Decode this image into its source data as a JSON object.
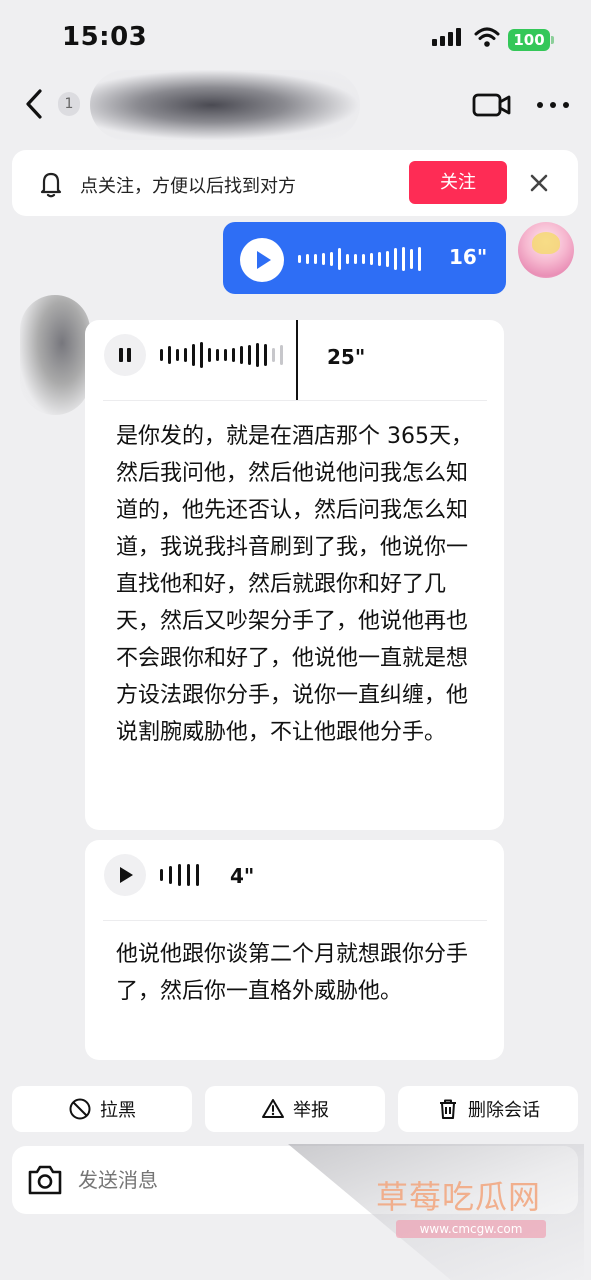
{
  "status_bar": {
    "time": "15:03",
    "battery": "100",
    "battery_color": "#34c759"
  },
  "header": {
    "unread_count": "1",
    "icons": [
      "back-icon",
      "video-call-icon",
      "more-icon"
    ]
  },
  "follow_banner": {
    "text": "点关注，方便以后找到对方",
    "button_label": "关注",
    "button_color": "#fe2c55"
  },
  "messages": [
    {
      "from": "me",
      "type": "voice",
      "duration": "16\"",
      "bubble_color": "#2e6ef5"
    },
    {
      "from": "other",
      "type": "voice",
      "state": "playing",
      "duration": "25\"",
      "transcript": "是你发的，就是在酒店那个 365天，然后我问他，然后他说他问我怎么知道的，他先还否认，然后问我怎么知道，我说我抖音刷到了我，他说你一直找他和好，然后就跟你和好了几天，然后又吵架分手了，他说他再也不会跟你和好了，他说他一直就是想方设法跟你分手，说你一直纠缠，他说割腕威胁他，不让他跟他分手。"
    },
    {
      "from": "other",
      "type": "voice",
      "state": "paused",
      "duration": "4\"",
      "transcript": "他说他跟你谈第二个月就想跟你分手了，然后你一直格外威胁他。"
    }
  ],
  "actions": {
    "block_label": "拉黑",
    "report_label": "举报",
    "delete_label": "删除会话"
  },
  "composer": {
    "placeholder": "发送消息"
  },
  "watermark": {
    "title": "草莓吃瓜网",
    "url": "www.cmcgw.com"
  }
}
